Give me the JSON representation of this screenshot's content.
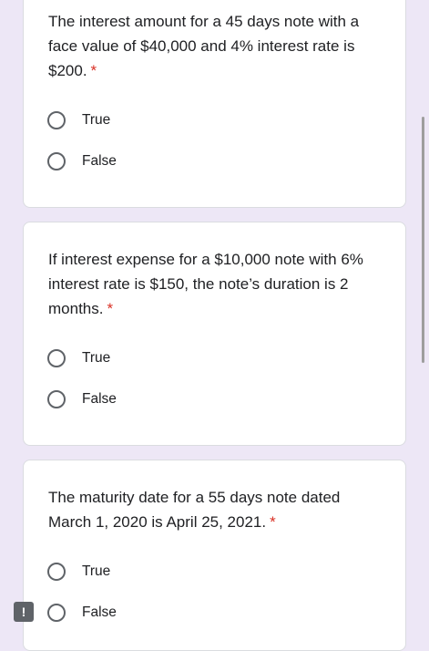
{
  "questions": [
    {
      "text": "The interest amount for a 45 days note with a face value of $40,000 and 4% interest rate is $200.",
      "required_mark": "*",
      "options": [
        "True",
        "False"
      ]
    },
    {
      "text": "If interest expense for a $10,000 note with 6% interest rate is $150, the note’s duration is 2 months.",
      "required_mark": "*",
      "options": [
        "True",
        "False"
      ]
    },
    {
      "text": "The maturity date for a 55 days note dated March 1, 2020 is April 25, 2021.",
      "required_mark": "*",
      "options": [
        "True",
        "False"
      ]
    }
  ],
  "report_icon": "report-problem-icon",
  "report_glyph": "!",
  "colors": {
    "background": "#ede7f6",
    "card": "#ffffff",
    "required": "#d93025",
    "radio_border": "#5f6368"
  }
}
